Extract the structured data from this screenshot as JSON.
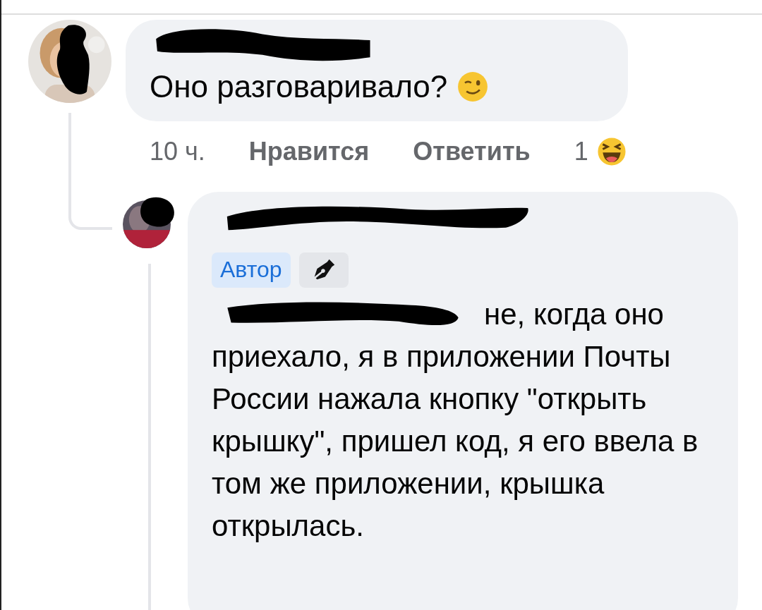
{
  "comment": {
    "text": "Оно разговаривало?",
    "emoji": {
      "kind": "wink"
    },
    "time": "10 ч.",
    "actions": [
      "Нравится",
      "Ответить"
    ],
    "reaction": {
      "count": "1",
      "kind": "laugh"
    }
  },
  "reply": {
    "badges": [
      {
        "kind": "label",
        "label": "Автор"
      },
      {
        "kind": "pen"
      }
    ],
    "mention_tail": "не, когда оно",
    "text": "приехало, я в приложении Почты России нажала кнопку \"открыть крышку\", пришел код, я его ввела в том же приложении, крышка открылась."
  }
}
